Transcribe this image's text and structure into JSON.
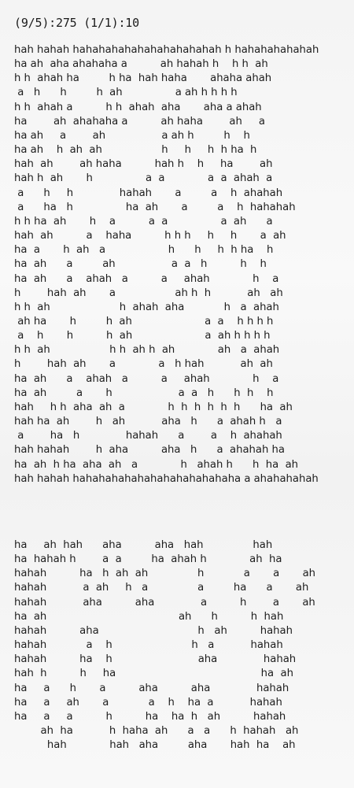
{
  "status_line": "(9/5):275 (1/1):10",
  "block1_lines": [
    "hah hahah hahahahahahahahahahahah h hahahahahahah",
    "ha ah  aha ahahaha a          ah hahah h    h h  ah",
    "h h  ahah ha         h ha  hah haha       ahaha ahah",
    " a   h      h         h  ah                a ah h h h h",
    "h h  ahah a          h h  ahah  aha       aha a ahah",
    "ha        ah  ahahaha a          ah haha        ah     a",
    "ha ah     a        ah                 a ah h         h    h",
    "ha ah    h  ah  ah                  h     h     h  h ha  h",
    "hah  ah        ah haha          hah h    h     ha        ah",
    "hah h  ah       h                a  a             a  a  ahah  a",
    " a      h     h              hahah       a         a    h  ahahah",
    " a      ha   h                ha  ah       a         a    h  hahahah",
    "h h ha  ah       h    a          a  a                a  ah      a",
    "hah  ah          a    haha          h h h     h     h       a  ah",
    "ha  a       h  ah   a                   h      h     h  h ha    h",
    "ha  ah      a         ah                 a  a   h          h    h",
    "ha  ah      a    ahah   a          a     ahah             h    a",
    "h        hah  ah       a                  ah h  h           ah   ah",
    "h h  ah                     h  ahah  aha            h   a  ahah",
    " ah ha       h         h  ah                      a  a    h h h h",
    " a    h       h          h  ah                      a  ah h h h h",
    "h h  ah                  h h  ah h  ah             ah   a  ahah",
    "h        hah  ah       a             a   h hah           ah  ah",
    "ha  ah      a    ahah   a          a     ahah             h    a",
    "ha  ah         a       h                    a  a   h      h  h    h",
    "hah     h h  aha  ah  a             h  h  h  h  h  h      ha  ah",
    "hah ha  ah        h   ah           aha   h      a  ahah h   a",
    " a        ha   h              hahah      a        a    h  ahahah",
    "hah hahah        h  aha          aha   h      a  ahahah ha",
    "ha  ah  h ha  aha  ah   a             h   ahah h      h  ha  ah",
    "hah hahah hahahahahahahahahahahahaha a ahahahahah"
  ],
  "block2_lines": [
    "ha     ah  hah      aha          aha   hah               hah",
    "ha  hahah h        a  a         ha  ahah h             ah  ha",
    "hahah          ha   h  ah  ah               h            a       a       ah",
    "hahah           a  ah     h   a               a         ha      a       ah",
    "hahah           aha          aha              a          h        a       ah",
    "ha  ah                                        ah      h          h  hah",
    "hahah          aha                              h   ah          hahah",
    "hahah            a    h                        h   a           hahah",
    "hahah          ha    h                          aha              hahah",
    "hah  h          h     ha                                            ha  ah",
    "ha     a      h       a          aha          aha              hahah",
    "ha     a     ah       a            a    h    ha  a           hahah",
    "ha     a     a          h          ha    ha  h   ah          hahah",
    "        ah  ha           h  haha  ah      a   a      h  hahah   ah",
    "          hah             hah   aha         aha       hah  ha    ah"
  ]
}
